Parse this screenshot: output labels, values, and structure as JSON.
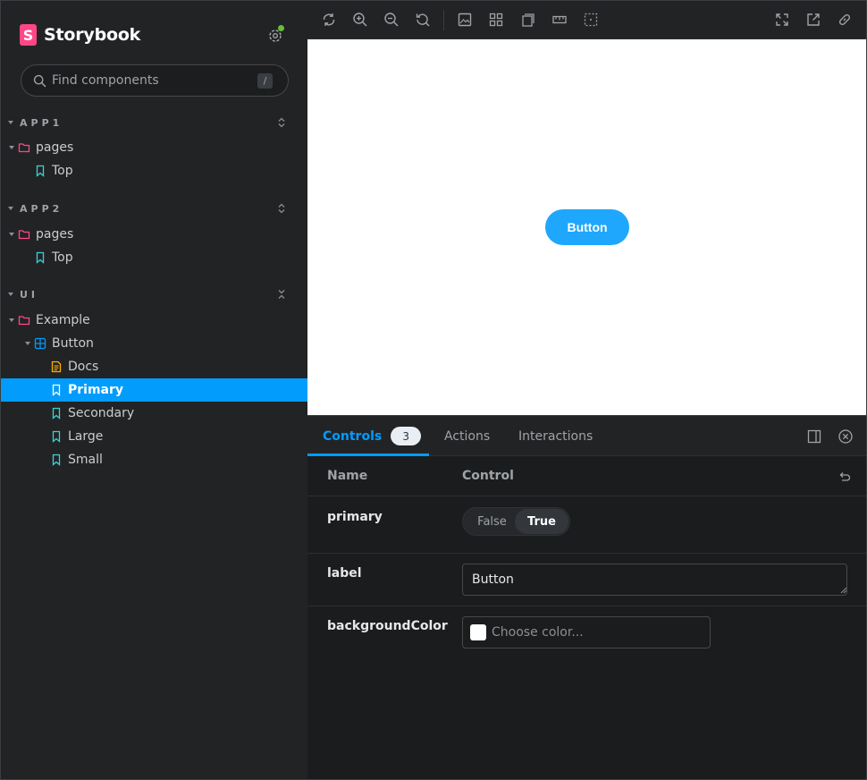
{
  "app": {
    "brand_logo_letter": "S",
    "brand_name": "Storybook",
    "accent_color": "#029cfd",
    "brand_color": "#ff4785"
  },
  "search": {
    "placeholder": "Find components",
    "shortcut": "/"
  },
  "groups": [
    {
      "label": "APP1",
      "items": [
        {
          "label": "pages",
          "icon": "folder-icon"
        },
        {
          "label": "Top",
          "icon": "story-bookmark-icon"
        }
      ]
    },
    {
      "label": "APP2",
      "items": [
        {
          "label": "pages",
          "icon": "folder-icon"
        },
        {
          "label": "Top",
          "icon": "story-bookmark-icon"
        }
      ]
    },
    {
      "label": "UI",
      "items": [
        {
          "label": "Example",
          "icon": "folder-icon"
        },
        {
          "label": "Button",
          "icon": "component-icon"
        },
        {
          "label": "Docs",
          "icon": "docs-icon"
        },
        {
          "label": "Primary",
          "icon": "story-bookmark-icon",
          "selected": true
        },
        {
          "label": "Secondary",
          "icon": "story-bookmark-icon"
        },
        {
          "label": "Large",
          "icon": "story-bookmark-icon"
        },
        {
          "label": "Small",
          "icon": "story-bookmark-icon"
        }
      ]
    }
  ],
  "toolbar": {
    "left_tools": [
      "reload-icon",
      "zoom-in-icon",
      "zoom-out-icon",
      "reset-zoom-icon",
      "background-icon",
      "grid-icon",
      "viewport-icon",
      "measure-icon",
      "outline-icon"
    ],
    "right_tools": [
      "fullscreen-icon",
      "open-new-tab-icon",
      "copy-link-icon"
    ]
  },
  "preview": {
    "button_label": "Button",
    "button_color": "#1ea7fd"
  },
  "panel": {
    "tabs": [
      {
        "label": "Controls",
        "badge": "3",
        "active": true
      },
      {
        "label": "Actions"
      },
      {
        "label": "Interactions"
      }
    ],
    "header": {
      "name": "Name",
      "control": "Control"
    },
    "rows": {
      "primary": {
        "name": "primary",
        "false_label": "False",
        "true_label": "True",
        "value": true
      },
      "label": {
        "name": "label",
        "value": "Button"
      },
      "background": {
        "name": "backgroundColor",
        "placeholder": "Choose color..."
      }
    }
  }
}
